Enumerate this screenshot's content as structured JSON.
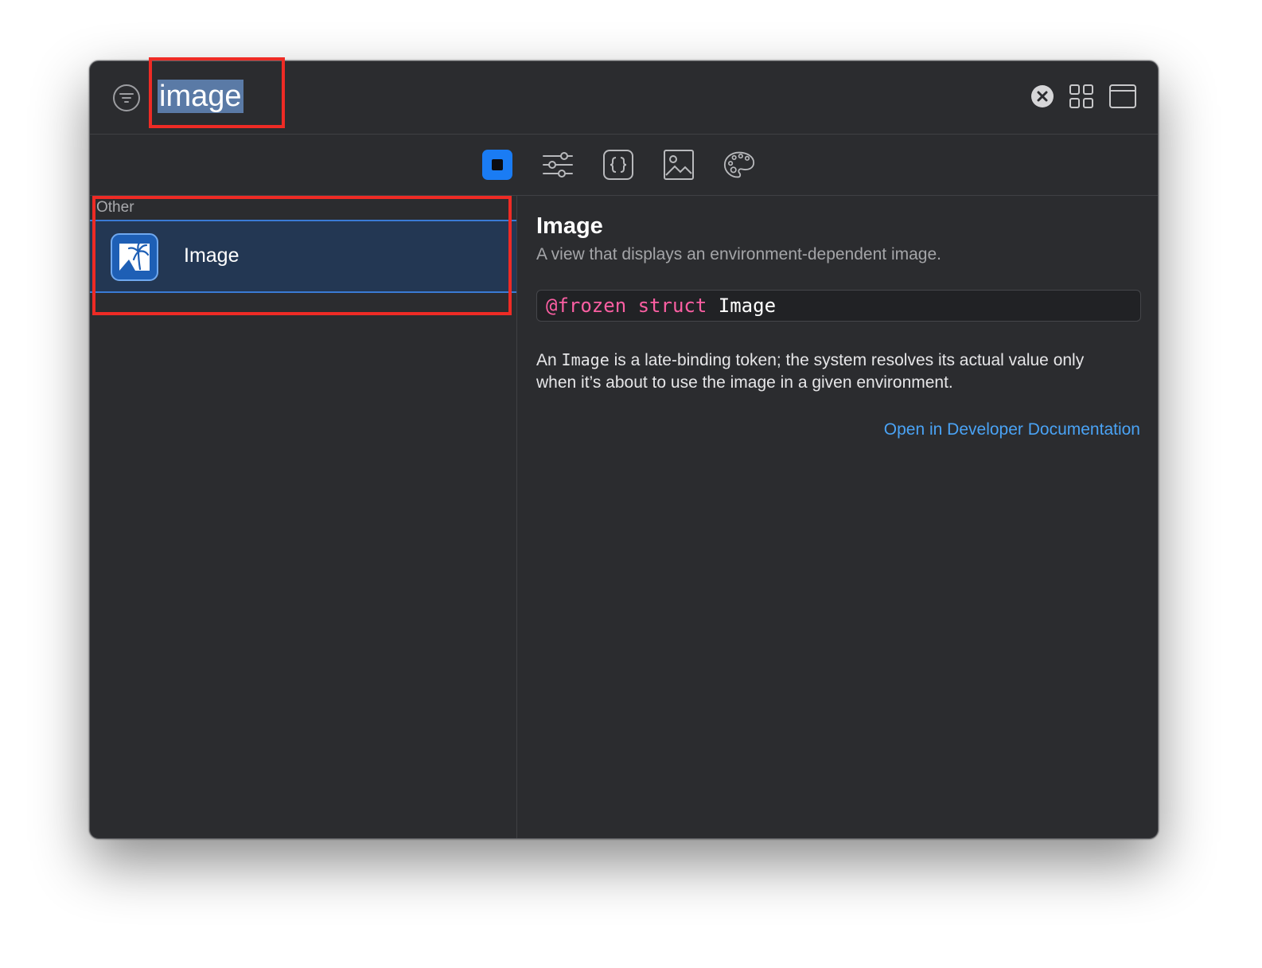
{
  "search": {
    "query": "image"
  },
  "toolbar": {
    "filter_icon": "filter-icon",
    "clear_icon": "clear-circle-icon",
    "grid_icon": "grid-view-icon",
    "window_icon": "window-icon"
  },
  "tabs": [
    {
      "icon": "views-icon",
      "active": true
    },
    {
      "icon": "modifiers-icon",
      "active": false
    },
    {
      "icon": "snippets-icon",
      "active": false
    },
    {
      "icon": "image-icon",
      "active": false
    },
    {
      "icon": "color-palette-icon",
      "active": false
    }
  ],
  "results": {
    "section_title": "Other",
    "items": [
      {
        "label": "Image",
        "icon": "image-view-icon",
        "selected": true
      }
    ]
  },
  "detail": {
    "title": "Image",
    "subtitle": "A view that displays an environment-dependent image.",
    "declaration": {
      "attribute": "@frozen",
      "keyword": "struct",
      "name": "Image"
    },
    "body": {
      "pre": "An ",
      "code": "Image",
      "post": " is a late-binding token; the system resolves its actual value only when it’s about to use the image in a given environment."
    },
    "link": "Open in Developer Documentation"
  },
  "colors": {
    "accent": "#1a7cf4",
    "selection": "#233753",
    "link": "#4aa3f5",
    "keyword": "#fc5fa3",
    "annotation": "#ee2b25"
  }
}
